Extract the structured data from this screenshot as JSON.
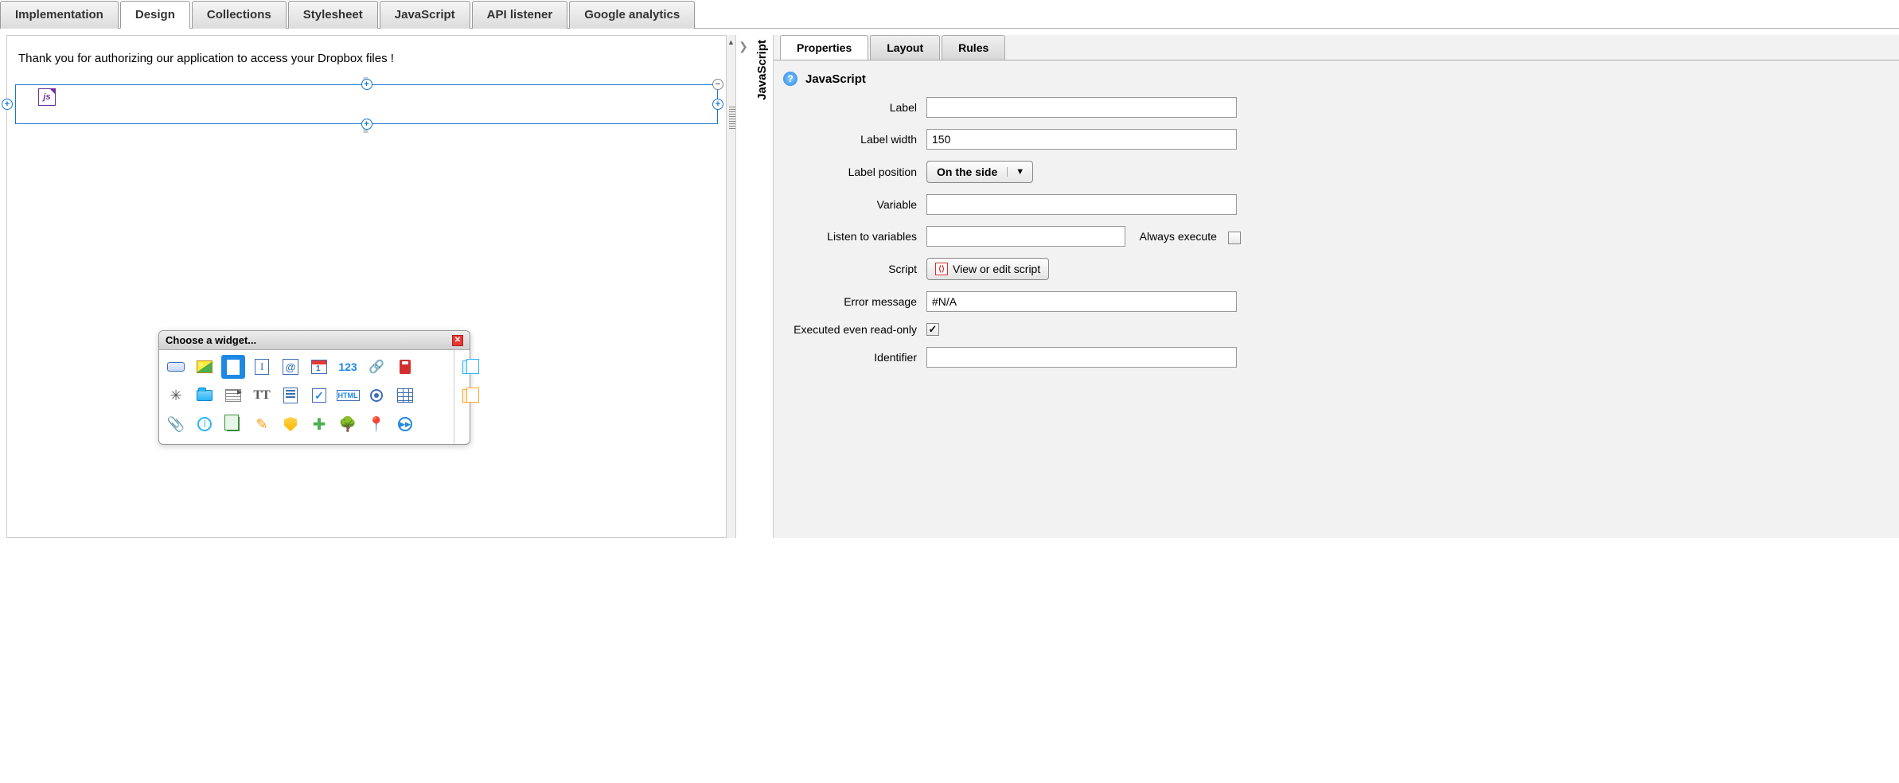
{
  "topTabs": {
    "implementation": "Implementation",
    "design": "Design",
    "collections": "Collections",
    "stylesheet": "Stylesheet",
    "javascript": "JavaScript",
    "apiListener": "API listener",
    "googleAnalytics": "Google analytics"
  },
  "canvas": {
    "message": "Thank you for authorizing our application to access your Dropbox files !",
    "jsBadge": "js"
  },
  "sideLabel": "JavaScript",
  "palette": {
    "title": "Choose a widget...",
    "num": "123",
    "at": "@",
    "tt": "TT",
    "html": "HTML",
    "next": "▶▶"
  },
  "propsTabs": {
    "properties": "Properties",
    "layout": "Layout",
    "rules": "Rules"
  },
  "props": {
    "sectionTitle": "JavaScript",
    "labels": {
      "label": "Label",
      "labelWidth": "Label width",
      "labelPosition": "Label position",
      "variable": "Variable",
      "listen": "Listen to variables",
      "script": "Script",
      "errMsg": "Error message",
      "execRO": "Executed even read-only",
      "identifier": "Identifier"
    },
    "values": {
      "label": "",
      "labelWidth": "150",
      "labelPosition": "On the side",
      "variable": "",
      "listen": "",
      "alwaysExecute": "Always execute",
      "scriptBtn": "View or edit script",
      "errMsg": "#N/A",
      "execROChecked": true,
      "identifier": ""
    }
  }
}
